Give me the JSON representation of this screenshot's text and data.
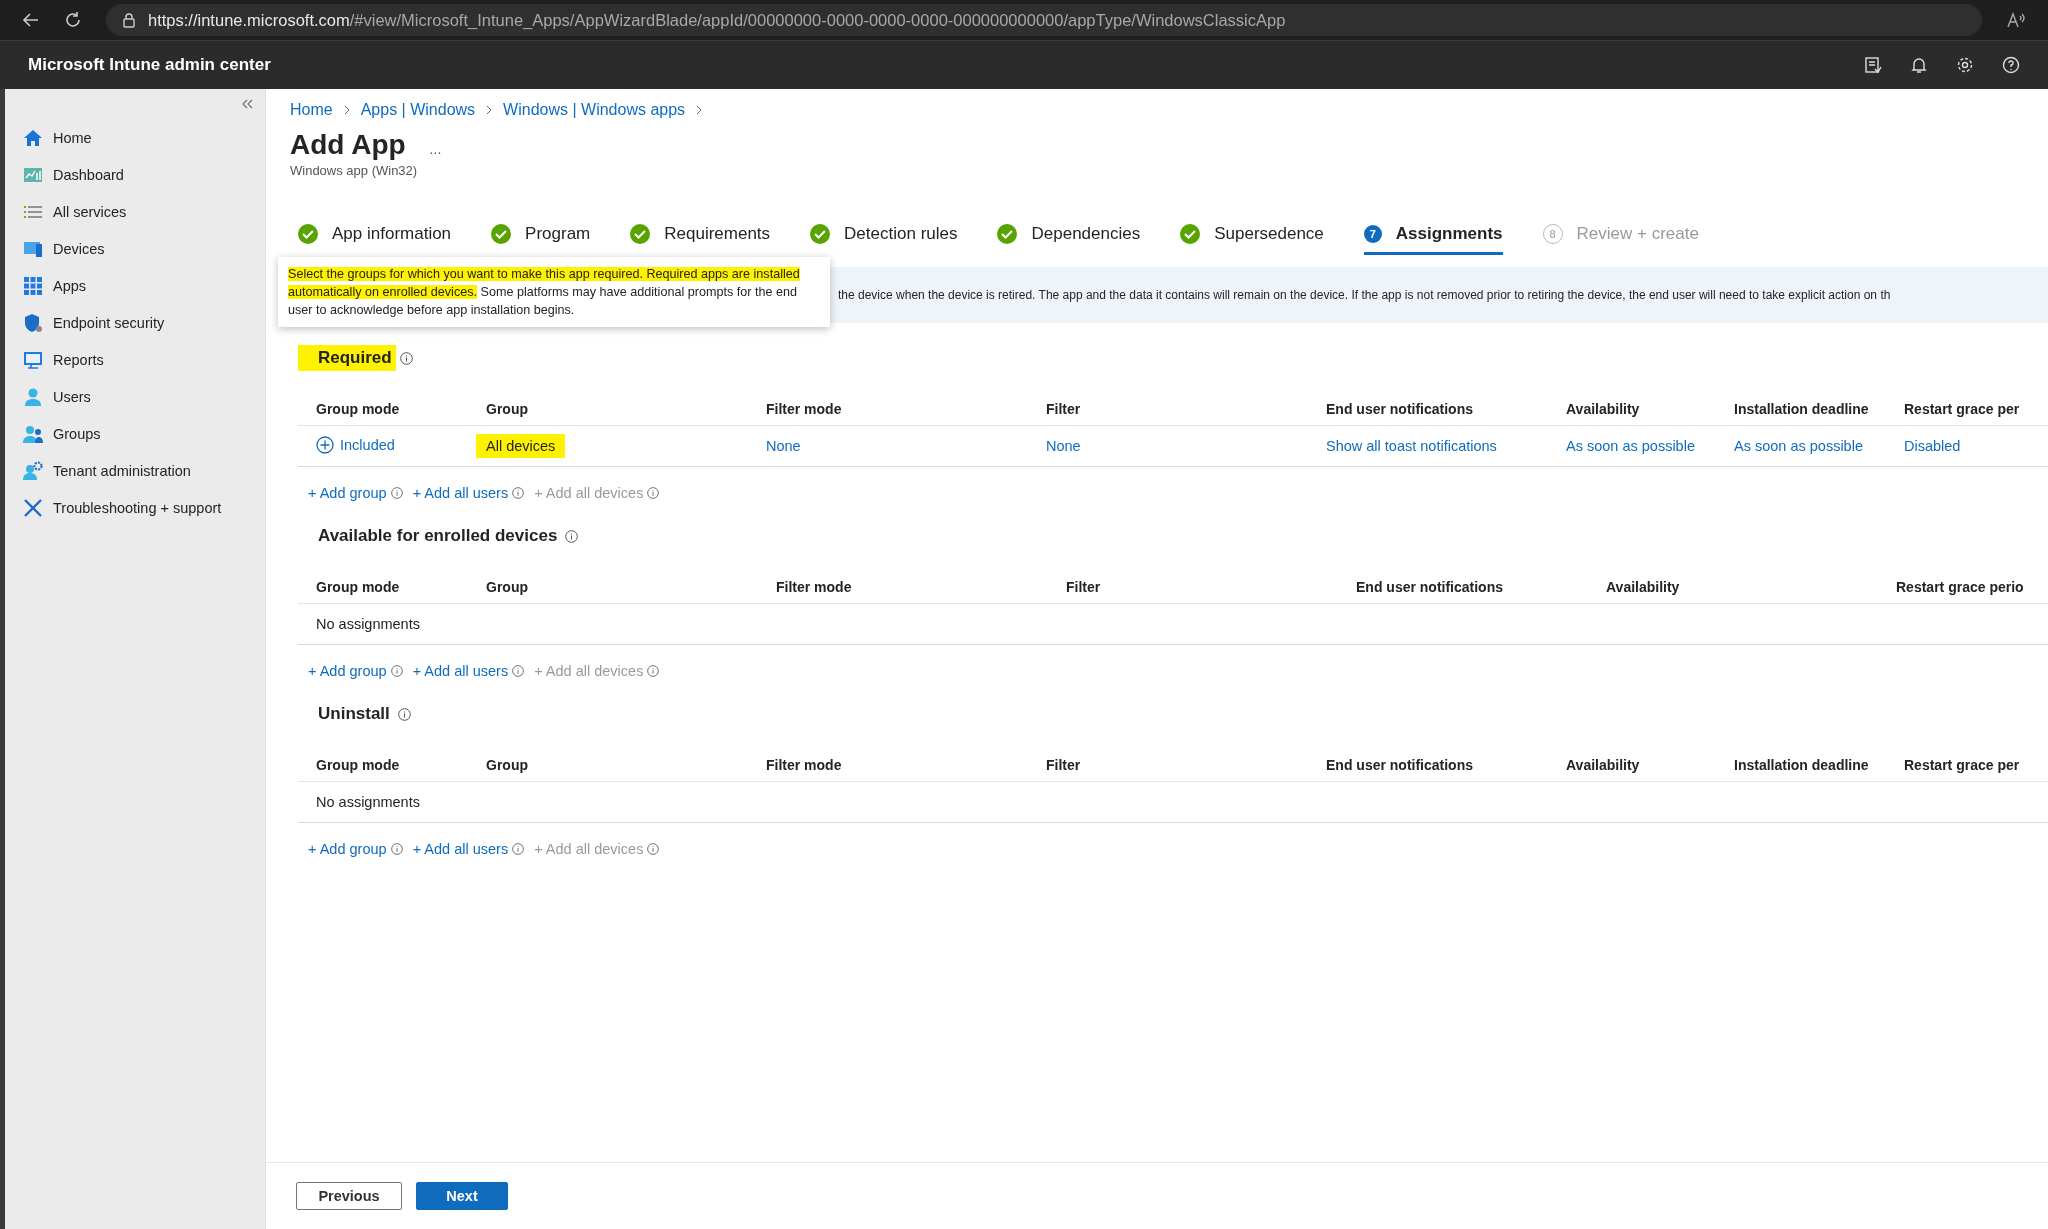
{
  "browser": {
    "url_host": "https://intune.microsoft.com",
    "url_path": "/#view/Microsoft_Intune_Apps/AppWizardBlade/appId/00000000-0000-0000-0000-000000000000/appType/WindowsClassicApp"
  },
  "header": {
    "title": "Microsoft Intune admin center"
  },
  "sidebar": {
    "items": [
      {
        "label": "Home",
        "selected": false
      },
      {
        "label": "Dashboard",
        "selected": false
      },
      {
        "label": "All services",
        "selected": false
      },
      {
        "label": "Devices",
        "selected": false
      },
      {
        "label": "Apps",
        "selected": false
      },
      {
        "label": "Endpoint security",
        "selected": false
      },
      {
        "label": "Reports",
        "selected": false
      },
      {
        "label": "Users",
        "selected": false
      },
      {
        "label": "Groups",
        "selected": false
      },
      {
        "label": "Tenant administration",
        "selected": false
      },
      {
        "label": "Troubleshooting + support",
        "selected": false
      }
    ]
  },
  "breadcrumb": [
    "Home",
    "Apps | Windows",
    "Windows | Windows apps"
  ],
  "page": {
    "title": "Add App",
    "more": "...",
    "subtitle": "Windows app (Win32)"
  },
  "steps": [
    {
      "label": "App information",
      "kind": "done",
      "selected": false
    },
    {
      "label": "Program",
      "kind": "done",
      "selected": false
    },
    {
      "label": "Requirements",
      "kind": "done",
      "selected": false
    },
    {
      "label": "Detection rules",
      "kind": "done",
      "selected": false
    },
    {
      "label": "Dependencies",
      "kind": "done",
      "selected": false
    },
    {
      "label": "Supersedence",
      "kind": "done",
      "selected": false
    },
    {
      "label": "Assignments",
      "kind": "current",
      "number": "7",
      "selected": true
    },
    {
      "label": "Review + create",
      "kind": "pending",
      "number": "8",
      "selected": false
    }
  ],
  "banner": {
    "text": "the device when the device is retired. The app and the data it contains will remain on the device. If the app is not removed prior to retiring the device, the end user will need to take explicit action on th"
  },
  "tooltip": {
    "highlighted_text": "Select the groups for which you want to make this app required. Required apps are installed automatically on enrolled devices.",
    "text": " Some platforms may have additional prompts for the end user to acknowledge before app installation begins."
  },
  "sections": [
    {
      "title": "Required",
      "highlighted": true,
      "columns": [
        "Group mode",
        "Group",
        "Filter mode",
        "Filter",
        "End user notifications",
        "Availability",
        "Installation deadline",
        "Restart grace per"
      ],
      "rows": [
        {
          "kind": "assignment",
          "cells": [
            {
              "text": "Included",
              "kind": "mode",
              "highlighted": false
            },
            {
              "text": "All devices",
              "kind": "plain",
              "highlighted": true
            },
            {
              "text": "None",
              "kind": "link",
              "highlighted": false
            },
            {
              "text": "None",
              "kind": "link",
              "highlighted": false
            },
            {
              "text": "Show all toast notifications",
              "kind": "link",
              "highlighted": false
            },
            {
              "text": "As soon as possible",
              "kind": "link",
              "highlighted": false
            },
            {
              "text": "As soon as possible",
              "kind": "link",
              "highlighted": false
            },
            {
              "text": "Disabled",
              "kind": "link",
              "highlighted": false
            }
          ]
        }
      ],
      "actions": [
        {
          "text": "+ Add group",
          "disabled": false
        },
        {
          "text": "+ Add all users",
          "disabled": false
        },
        {
          "text": "+ Add all devices",
          "disabled": true
        }
      ]
    },
    {
      "title": "Available for enrolled devices",
      "highlighted": false,
      "columns": [
        "Group mode",
        "Group",
        "Filter mode",
        "Filter",
        "End user notifications",
        "Availability",
        "Restart grace perio"
      ],
      "rows": [
        {
          "kind": "empty",
          "text": "No assignments"
        }
      ],
      "actions": [
        {
          "text": "+ Add group",
          "disabled": false
        },
        {
          "text": "+ Add all users",
          "disabled": false
        },
        {
          "text": "+ Add all devices",
          "disabled": true
        }
      ]
    },
    {
      "title": "Uninstall",
      "highlighted": false,
      "columns": [
        "Group mode",
        "Group",
        "Filter mode",
        "Filter",
        "End user notifications",
        "Availability",
        "Installation deadline",
        "Restart grace per"
      ],
      "rows": [
        {
          "kind": "empty",
          "text": "No assignments"
        }
      ],
      "actions": [
        {
          "text": "+ Add group",
          "disabled": false
        },
        {
          "text": "+ Add all users",
          "disabled": false
        },
        {
          "text": "+ Add all devices",
          "disabled": true
        }
      ]
    }
  ],
  "footer": {
    "buttons": [
      {
        "label": "Previous",
        "kind": "secondary"
      },
      {
        "label": "Next",
        "kind": "primary"
      }
    ]
  }
}
